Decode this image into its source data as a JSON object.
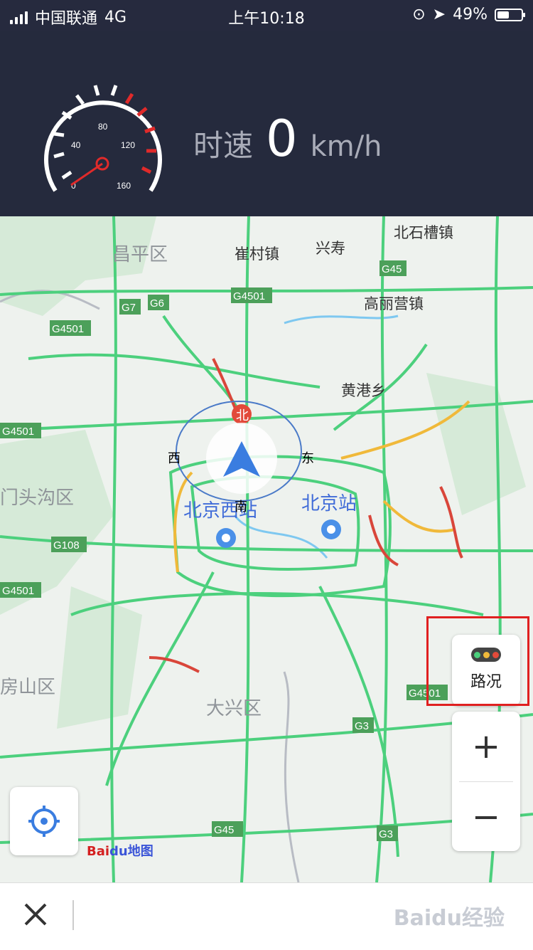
{
  "status_bar": {
    "carrier": "中国联通",
    "network": "4G",
    "time": "上午10:18",
    "battery": "49%"
  },
  "speed_panel": {
    "label": "时速",
    "value": "0",
    "unit": "km/h",
    "gauge_ticks": [
      "0",
      "40",
      "80",
      "120",
      "160"
    ]
  },
  "map": {
    "places": [
      "昌平区",
      "崔村镇",
      "兴寿",
      "北石槽镇",
      "高丽营镇",
      "黄港乡",
      "门头沟区",
      "北京西站",
      "北京站",
      "房山区",
      "大兴区"
    ],
    "roads": [
      "G45",
      "G4501",
      "G7",
      "G6",
      "G4501",
      "G4501",
      "G108",
      "G4501",
      "G4501",
      "G3",
      "G45",
      "G3"
    ],
    "compass": {
      "north": "北",
      "west": "西",
      "east": "东",
      "south": "南"
    }
  },
  "controls": {
    "traffic_label": "路况",
    "zoom_in": "+",
    "zoom_out": "−"
  },
  "logo": {
    "text1": "Bai",
    "text2": "du地图"
  },
  "bottom_bar": {
    "watermark": "Baidu经验"
  },
  "colors": {
    "traffic_green": "#4cd07d",
    "traffic_red": "#d9463a",
    "traffic_yellow": "#f0b93a",
    "accent": "#3a7de0"
  }
}
